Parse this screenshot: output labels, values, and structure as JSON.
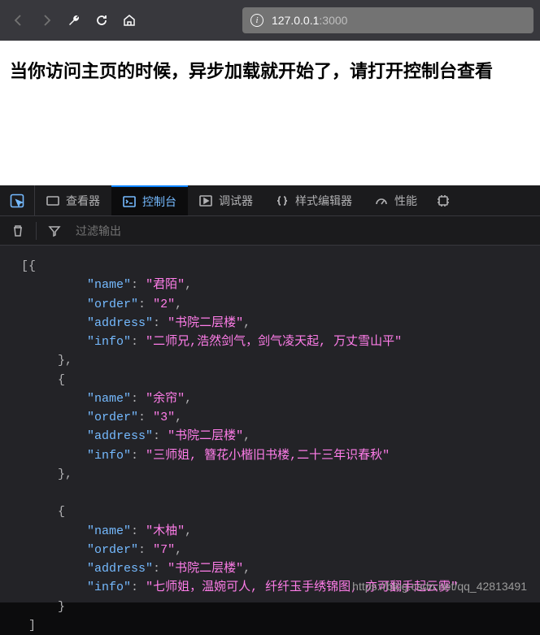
{
  "url": {
    "host": "127.0.0.1",
    "port": ":3000"
  },
  "page": {
    "heading": "当你访问主页的时候，异步加载就开始了，请打开控制台查看"
  },
  "devtools": {
    "tabs": {
      "inspector": "查看器",
      "console": "控制台",
      "debugger": "调试器",
      "style_editor": "样式编辑器",
      "performance": "性能"
    },
    "filter_placeholder": "过滤输出"
  },
  "console_output": "[{\n         \"name\": \"君陌\",\n         \"order\": \"2\",\n         \"address\": \"书院二层楼\",\n         \"info\": \"二师兄,浩然剑气，剑气凌天起, 万丈雪山平\"\n     },\n     {\n         \"name\": \"余帘\",\n         \"order\": \"3\",\n         \"address\": \"书院二层楼\",\n         \"info\": \"三师姐, 簪花小楷旧书楼,二十三年识春秋\"\n     },\n\n     {\n         \"name\": \"木柚\",\n         \"order\": \"7\",\n         \"address\": \"书院二层楼\",\n         \"info\": \"七师姐，温婉可人, 纤纤玉手绣锦图, 亦可翻手起云雾\"\n     }\n ]",
  "watermark": "https://blog.csdn.net/qq_42813491"
}
